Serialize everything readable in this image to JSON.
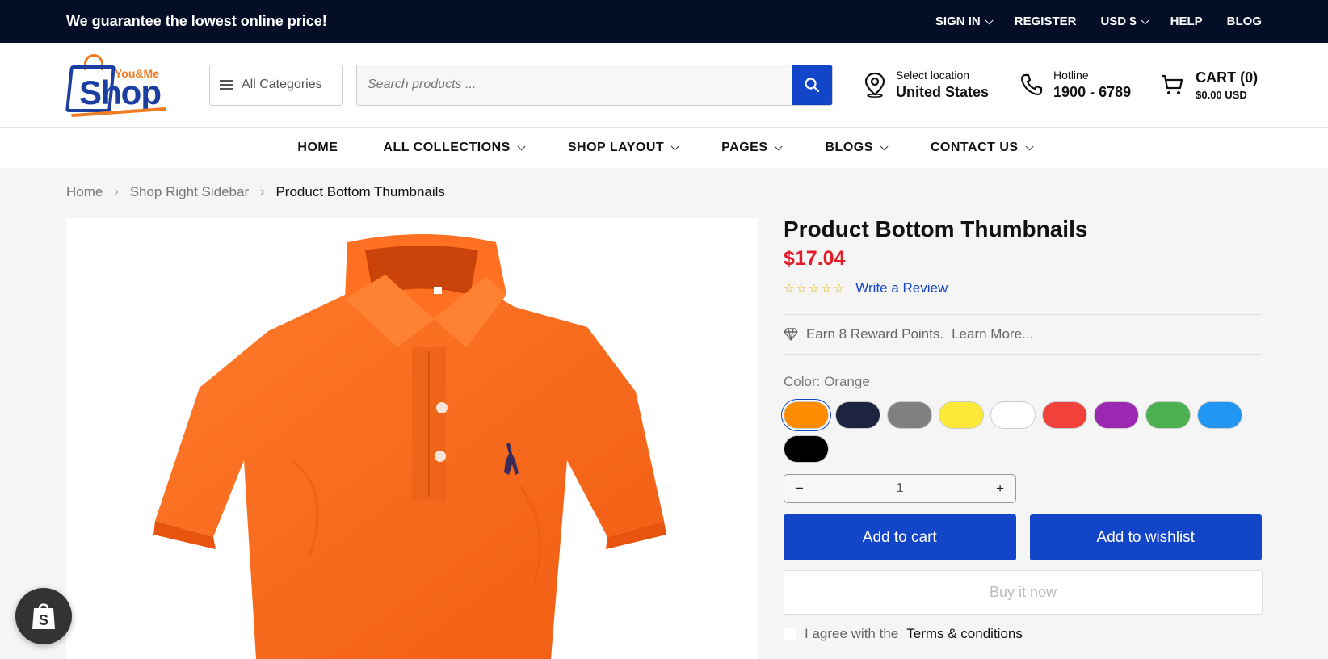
{
  "topbar": {
    "promo": "We guarantee the lowest online price!",
    "sign_in": "SIGN IN",
    "register": "REGISTER",
    "currency": "USD $",
    "help": "HELP",
    "blog": "BLOG"
  },
  "header": {
    "logo_small": "You&Me",
    "logo_big": "Shop",
    "all_categories": "All Categories",
    "search_placeholder": "Search products ...",
    "location_label": "Select location",
    "location_value": "United States",
    "hotline_label": "Hotline",
    "hotline_value": "1900 - 6789",
    "cart_label": "CART (0)",
    "cart_total": "$0.00 USD"
  },
  "nav": {
    "items": [
      {
        "label": "HOME"
      },
      {
        "label": "ALL COLLECTIONS"
      },
      {
        "label": "SHOP LAYOUT"
      },
      {
        "label": "PAGES"
      },
      {
        "label": "BLOGS"
      },
      {
        "label": "CONTACT US"
      }
    ]
  },
  "breadcrumb": {
    "home": "Home",
    "parent": "Shop Right Sidebar",
    "current": "Product Bottom Thumbnails"
  },
  "product": {
    "title": "Product Bottom Thumbnails",
    "price": "$17.04",
    "rating_stars": 0,
    "write_review": "Write a Review",
    "reward_text": "Earn 8 Reward Points.",
    "learn_more": "Learn More...",
    "color_label": "Color: Orange",
    "swatches": [
      {
        "name": "Orange",
        "hex": "#ff8c00",
        "selected": true
      },
      {
        "name": "Navy",
        "hex": "#1c2440"
      },
      {
        "name": "Gray",
        "hex": "#808080"
      },
      {
        "name": "Yellow",
        "hex": "#fde93a"
      },
      {
        "name": "White",
        "hex": "#ffffff"
      },
      {
        "name": "Red",
        "hex": "#f0413a"
      },
      {
        "name": "Purple",
        "hex": "#9c27b0"
      },
      {
        "name": "Green",
        "hex": "#4caf50"
      },
      {
        "name": "Blue",
        "hex": "#2196f3"
      },
      {
        "name": "Black",
        "hex": "#000000"
      }
    ],
    "quantity": "1",
    "add_to_cart": "Add to cart",
    "add_to_wishlist": "Add to wishlist",
    "buy_now": "Buy it now",
    "terms_prefix": "I agree with the",
    "terms_link": "Terms & conditions"
  },
  "colors": {
    "topbar_bg": "#050e27",
    "primary": "#1345c8",
    "price": "#e21d2a",
    "accent_orange": "#f07c22"
  }
}
